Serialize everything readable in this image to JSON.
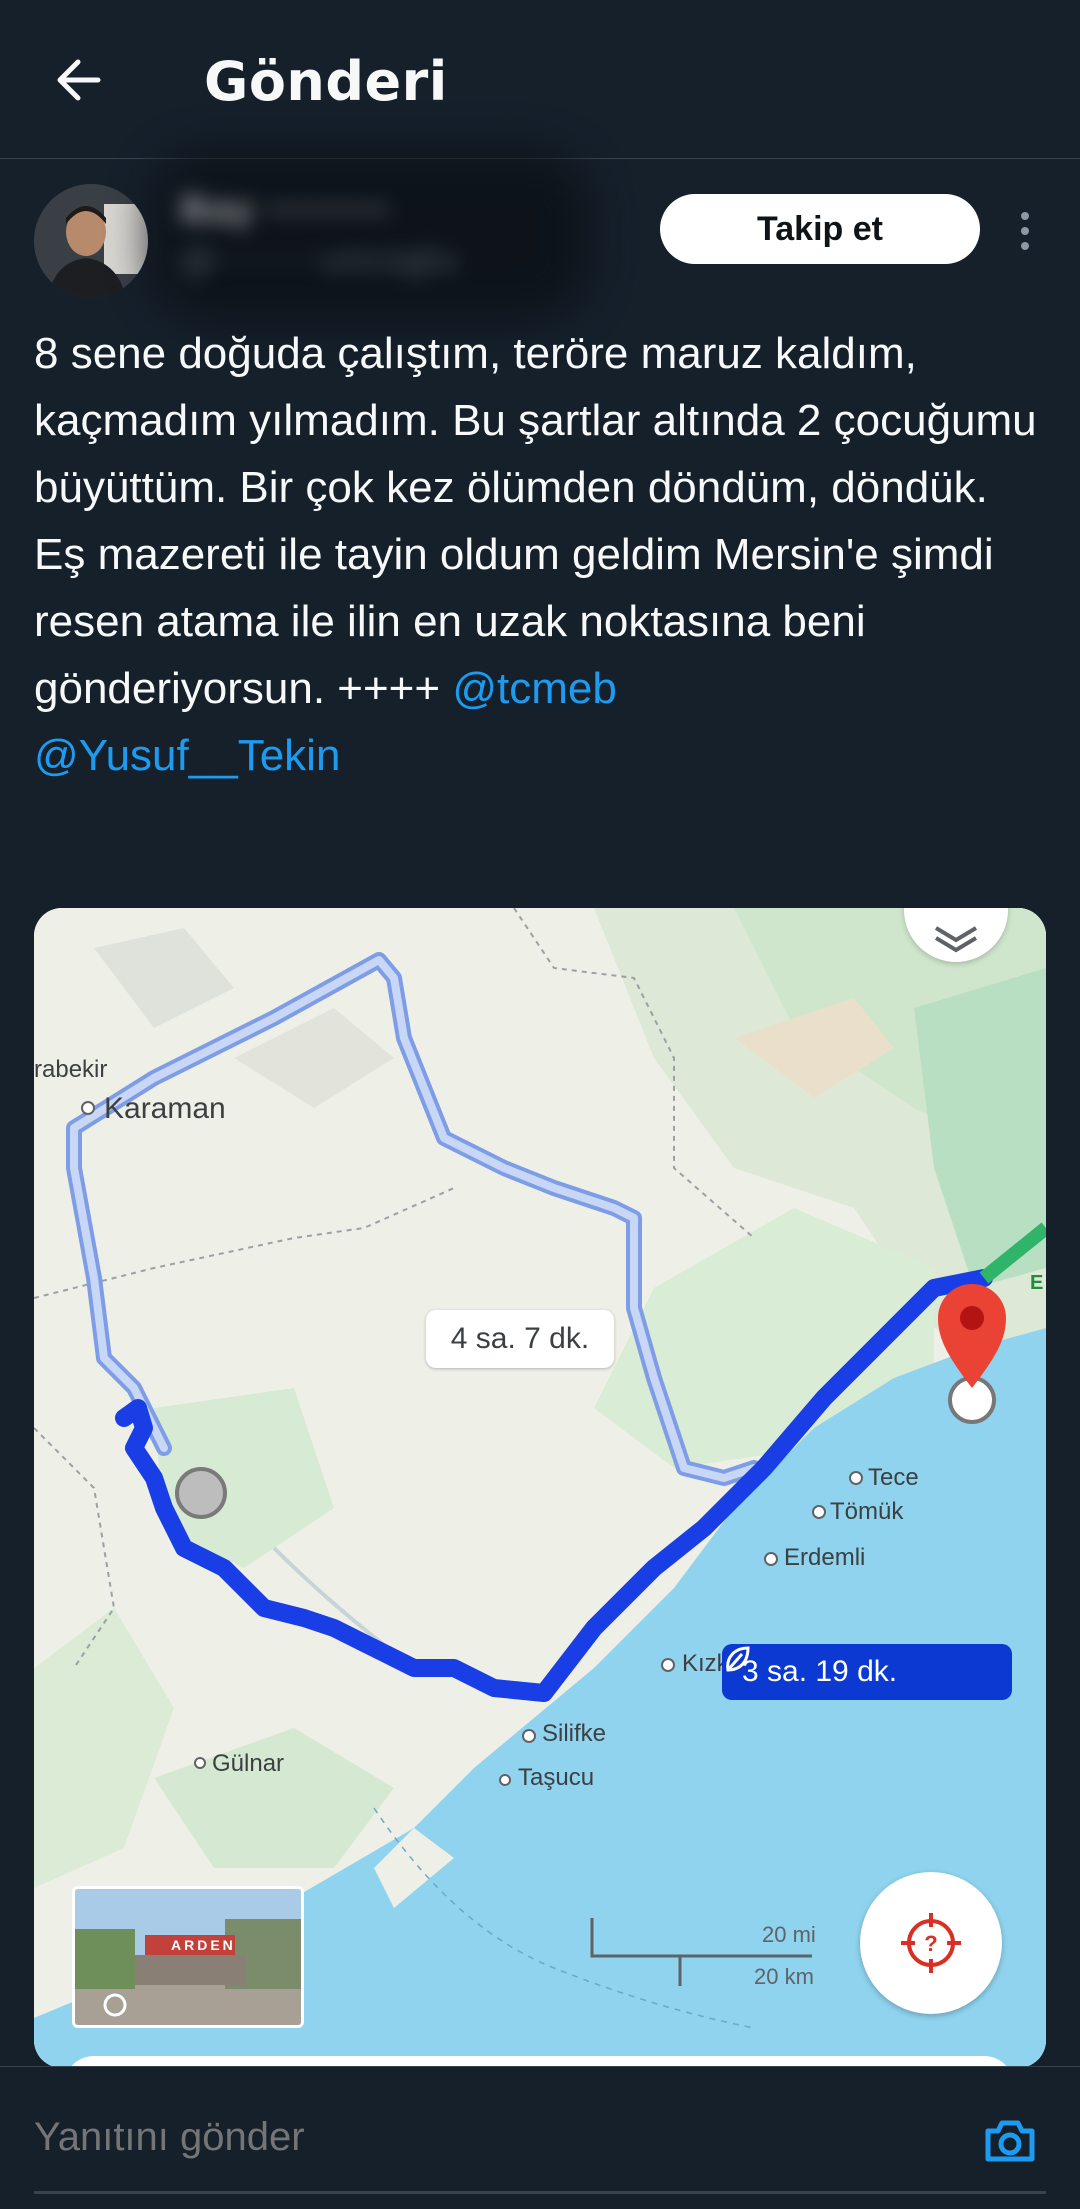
{
  "header": {
    "title": "Gönderi"
  },
  "author": {
    "name": "Bay ·········",
    "handle": "@··········uncoglu",
    "follow_label": "Takip et"
  },
  "tweet": {
    "text_plain": "8 sene doğuda çalıştım, teröre maruz kaldım, kaçmadım yılmadım. Bu şartlar altında 2 çocuğumu büyüttüm. Bir çok kez ölümden döndüm, döndük. Eş mazereti ile tayin oldum geldim Mersin'e şimdi resen atama ile ilin en uzak noktasına beni gönderiyorsun. ++++ ",
    "mention_1": "@tcmeb",
    "mention_2": "@Yusuf__Tekin"
  },
  "map": {
    "places": {
      "karabekir": "rabekir",
      "karaman": "Karaman",
      "gulnar": "Gülnar",
      "silifke": "Silifke",
      "tasucu": "Taşucu",
      "kizkalesi": "Kızk",
      "erdemli": "Erdemli",
      "tomuk": "Tömük",
      "tece": "Tece",
      "edge": "E"
    },
    "route_alt_label": "4 sa. 7 dk.",
    "route_main_label": "3 sa. 19 dk.",
    "scale_mi": "20 mi",
    "scale_km": "20 km",
    "street_sign": "ARDEN"
  },
  "reply": {
    "placeholder": "Yanıtını gönder"
  },
  "colors": {
    "background": "#15202b",
    "link": "#1d9bf0",
    "route_main": "#1a3ee6",
    "route_alt": "#a9bff2",
    "sea": "#8fd3ee",
    "pin": "#ea4335"
  },
  "icons": [
    "back-arrow-icon",
    "more-icon",
    "layers-icon",
    "location-target-icon",
    "leaf-icon",
    "camera-icon",
    "destination-pin-icon"
  ]
}
